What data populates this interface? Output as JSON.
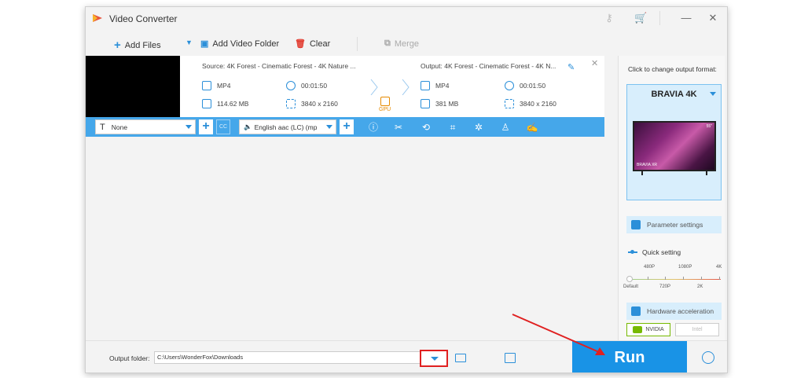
{
  "window": {
    "title": "Video Converter"
  },
  "toolbar": {
    "add_files": "Add Files",
    "add_video_folder": "Add Video Folder",
    "clear": "Clear",
    "merge": "Merge"
  },
  "item": {
    "source_title": "Source: 4K Forest - Cinematic Forest - 4K Nature ...",
    "source_format": "MP4",
    "source_duration": "00:01:50",
    "source_size": "114.62 MB",
    "source_resolution": "3840 x 2160",
    "output_title": "Output: 4K Forest - Cinematic Forest - 4K N...",
    "output_format": "MP4",
    "output_duration": "00:01:50",
    "output_size": "381 MB",
    "output_resolution": "3840 x 2160",
    "gpu_label": "GPU"
  },
  "editbar": {
    "subtitle_value": "None",
    "subtitle_prefix": "T",
    "cc_label": "CC",
    "audio_value": "English aac (LC) (mp"
  },
  "sidebar": {
    "caption": "Click to change output format:",
    "format_name": "BRAVIA 4K",
    "tv_brand": "BRAVIA XR",
    "tv_size": "55\"",
    "parameter_settings": "Parameter settings",
    "quick_setting": "Quick setting",
    "quality_top": [
      "480P",
      "1080P",
      "4K"
    ],
    "quality_bottom": [
      "Default",
      "720P",
      "2K"
    ],
    "hardware_acceleration": "Hardware acceleration",
    "nvidia": "NVIDIA",
    "intel": "Intel"
  },
  "bottom": {
    "output_folder_label": "Output folder:",
    "output_path": "C:\\Users\\WonderFox\\Downloads",
    "run": "Run"
  },
  "colors": {
    "accent": "#45a7ea",
    "run": "#1993e6",
    "highlight": "#e02020"
  }
}
